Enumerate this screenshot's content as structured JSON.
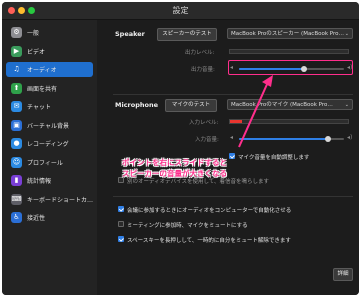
{
  "window": {
    "title": "設定"
  },
  "sidebar": {
    "items": [
      {
        "label": "一般",
        "icon": "gear-icon",
        "color": "#8e8e93"
      },
      {
        "label": "ビデオ",
        "icon": "video-icon",
        "color": "#3a9b5c"
      },
      {
        "label": "オーディオ",
        "icon": "headphones-icon",
        "color": "#1f6fcf",
        "active": true
      },
      {
        "label": "画面を共有",
        "icon": "screen-share-icon",
        "color": "#2fa14a"
      },
      {
        "label": "チャット",
        "icon": "chat-icon",
        "color": "#2b8ae2"
      },
      {
        "label": "バーチャル背景",
        "icon": "virtual-background-icon",
        "color": "#2b6fd6"
      },
      {
        "label": "レコーディング",
        "icon": "recording-icon",
        "color": "#2b8ae2"
      },
      {
        "label": "プロフィール",
        "icon": "profile-icon",
        "color": "#2b8ae2"
      },
      {
        "label": "統計情報",
        "icon": "statistics-icon",
        "color": "#7a3fd6"
      },
      {
        "label": "キーボードショートカ…",
        "icon": "keyboard-icon",
        "color": "#5e5e66"
      },
      {
        "label": "接近性",
        "icon": "accessibility-icon",
        "color": "#2b6fd6"
      }
    ]
  },
  "speaker": {
    "section_label": "Speaker",
    "test_button": "スピーカーのテスト",
    "device": "MacBook Proのスピーカー (MacBook Pro…",
    "output_level_label": "出力レベル:",
    "volume_label": "出力音量:",
    "volume_level": 0.62
  },
  "microphone": {
    "section_label": "Microphone",
    "test_button": "マイクのテスト",
    "device": "MacBook Proのマイク (MacBook Pro…",
    "input_level_label": "入力レベル:",
    "volume_label": "入力音量:",
    "volume_level": 0.85,
    "auto_adjust_label": "マイク音量を自動調整します",
    "separate_label": "別のオーディオデバイスを使用して、着信音を鳴らします"
  },
  "options": [
    {
      "label": "会議に参加するときにオーディオをコンピューターで自動化させる",
      "checked": true
    },
    {
      "label": "ミーティングに参加時、マイクをミュートにする",
      "checked": false
    },
    {
      "label": "スペースキーを長押しして、一時的に自分をミュート解除できます",
      "checked": true
    }
  ],
  "advanced_button": "詳細",
  "annotation": {
    "line1": "ポイントを右にスライドすると",
    "line2": "スピーカーの音量が大きくなる",
    "color": "#ff2e8c"
  }
}
